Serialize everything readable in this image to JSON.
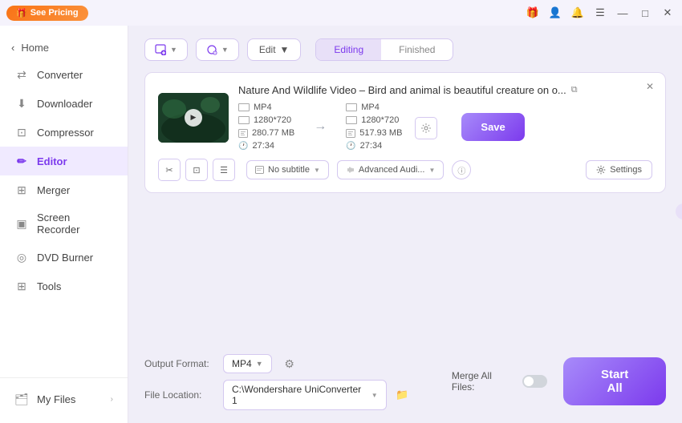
{
  "titlebar": {
    "see_pricing": "See Pricing",
    "icons": [
      "gift",
      "user",
      "bell",
      "menu",
      "minimize",
      "maximize",
      "close"
    ]
  },
  "sidebar": {
    "back_label": "Home",
    "items": [
      {
        "id": "converter",
        "label": "Converter",
        "icon": "⇄"
      },
      {
        "id": "downloader",
        "label": "Downloader",
        "icon": "↓"
      },
      {
        "id": "compressor",
        "label": "Compressor",
        "icon": "⊡"
      },
      {
        "id": "editor",
        "label": "Editor",
        "icon": "✎",
        "active": true
      },
      {
        "id": "merger",
        "label": "Merger",
        "icon": "⊞"
      },
      {
        "id": "screen-recorder",
        "label": "Screen Recorder",
        "icon": "▣"
      },
      {
        "id": "dvd-burner",
        "label": "DVD Burner",
        "icon": "◎"
      },
      {
        "id": "tools",
        "label": "Tools",
        "icon": "⊞"
      }
    ],
    "my_files": "My Files"
  },
  "toolbar": {
    "add_btn_icon": "+",
    "rotate_btn_icon": "↺",
    "edit_label": "Edit",
    "tabs": [
      {
        "id": "editing",
        "label": "Editing",
        "active": true
      },
      {
        "id": "finished",
        "label": "Finished",
        "active": false
      }
    ]
  },
  "video_card": {
    "title": "Nature And Wildlife Video – Bird and animal is beautiful creature on o...",
    "source": {
      "format": "MP4",
      "resolution": "1280*720",
      "size": "280.77 MB",
      "duration": "27:34"
    },
    "target": {
      "format": "MP4",
      "resolution": "1280*720",
      "size": "517.93 MB",
      "duration": "27:34"
    },
    "save_label": "Save",
    "subtitle_label": "No subtitle",
    "audio_label": "Advanced Audi...",
    "settings_label": "Settings",
    "action_icons": [
      "cut",
      "crop",
      "list"
    ]
  },
  "footer": {
    "output_format_label": "Output Format:",
    "output_format_value": "MP4",
    "file_location_label": "File Location:",
    "file_location_value": "C:\\Wondershare UniConverter 1",
    "merge_all_label": "Merge All Files:",
    "start_all_label": "Start All"
  }
}
